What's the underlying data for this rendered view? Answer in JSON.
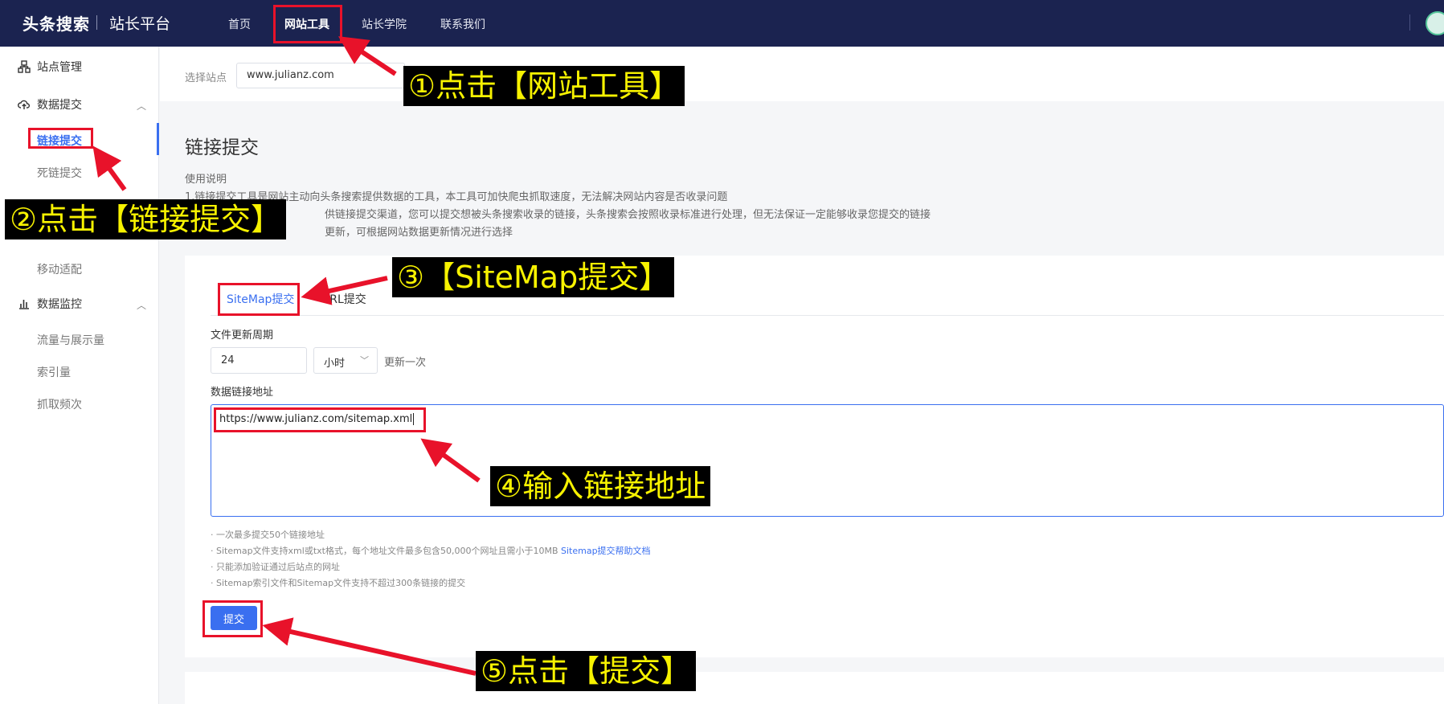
{
  "topbar": {
    "logo": "头条搜索",
    "logo_sub": "站长平台",
    "nav": [
      "首页",
      "网站工具",
      "站长学院",
      "联系我们"
    ]
  },
  "sidebar": {
    "site_manage": "站点管理",
    "data_submit": "数据提交",
    "link_submit": "链接提交",
    "dead_link": "死链提交",
    "mobile_adapt": "移动适配",
    "data_monitor": "数据监控",
    "traffic": "流量与展示量",
    "index": "索引量",
    "crawl": "抓取频次"
  },
  "site": {
    "label": "选择站点",
    "value": "www.julianz.com"
  },
  "page": {
    "title": "链接提交",
    "usage_title": "使用说明",
    "usage_lines": [
      "1.链接提交工具是网站主动向头条搜索提供数据的工具，本工具可加快爬虫抓取速度，无法解决网站内容是否收录问题",
      "供链接提交渠道，您可以提交想被头条搜索收录的链接，头条搜索会按照收录标准进行处理，但无法保证一定能够收录您提交的链接",
      "更新，可根据网站数据更新情况进行选择"
    ]
  },
  "tabs": {
    "sitemap": "SiteMap提交",
    "url": "URL提交"
  },
  "form": {
    "cycle_label": "文件更新周期",
    "cycle_value": "24",
    "unit": "小时",
    "update_text": "更新一次",
    "address_label": "数据链接地址",
    "address_value": "https://www.julianz.com/sitemap.xml",
    "hints": [
      "· 一次最多提交50个链接地址",
      "· Sitemap文件支持xml或txt格式，每个地址文件最多包含50,000个网址且需小于10MB",
      "· 只能添加验证通过后站点的网址",
      "· Sitemap索引文件和Sitemap文件支持不超过300条链接的提交"
    ],
    "help_link": "Sitemap提交帮助文档",
    "submit": "提交"
  },
  "annotations": {
    "step1": "①点击【网站工具】",
    "step2": "②点击【链接提交】",
    "step3": "③【SiteMap提交】",
    "step4": "④输入链接地址",
    "step5": "⑤点击【提交】"
  },
  "colors": {
    "nav_bg": "#1b2350",
    "accent": "#3a6ff0",
    "annotation_red": "#e8122a",
    "callout_text": "#f7f200"
  }
}
